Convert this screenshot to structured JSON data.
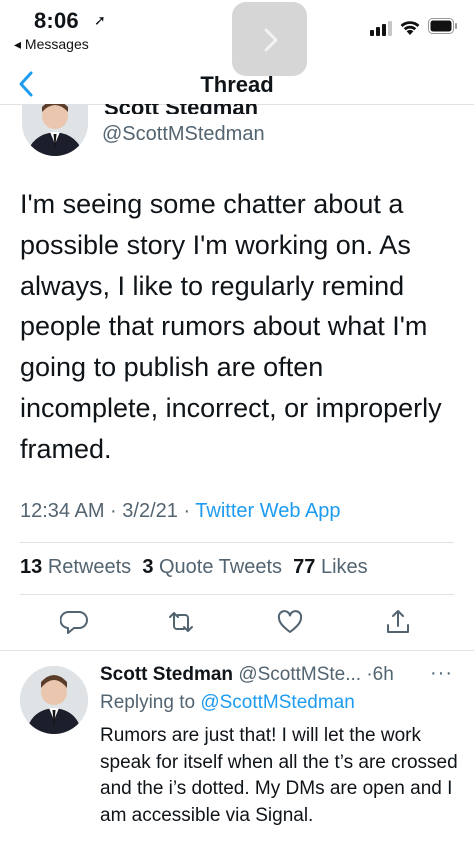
{
  "status": {
    "time": "8:06",
    "back_app": "◂ Messages",
    "location_glyph": "➚"
  },
  "nav": {
    "title": "Thread"
  },
  "main_tweet": {
    "name": "Scott Stedman",
    "handle": "@ScottMStedman",
    "text": "I'm seeing some chatter about a possible story I'm working on. As always, I like to regularly remind people that rumors about what I'm going to publish are often incomplete, incorrect, or improperly framed.",
    "timestamp": "12:34 AM · 3/2/21 · ",
    "source": "Twitter Web App",
    "retweets_count": "13",
    "retweets_label": "Retweets",
    "quotes_count": "3",
    "quotes_label": "Quote Tweets",
    "likes_count": "77",
    "likes_label": "Likes"
  },
  "actions": [
    "reply-icon",
    "retweet-icon",
    "like-icon",
    "share-icon"
  ],
  "reply": {
    "name": "Scott Stedman",
    "handle_time": "@ScottMSte... ·6h",
    "more": "···",
    "replying_prefix": "Replying to ",
    "replying_to": "@ScottMStedman",
    "text": "Rumors are just that! I will let the work speak for itself when all the t’s are crossed and the i’s dotted. My DMs are open and I am accessible via Signal."
  },
  "colors": {
    "accent": "#1d9bf0",
    "secondary_text": "#536471",
    "ios_blue": "#007aff"
  }
}
